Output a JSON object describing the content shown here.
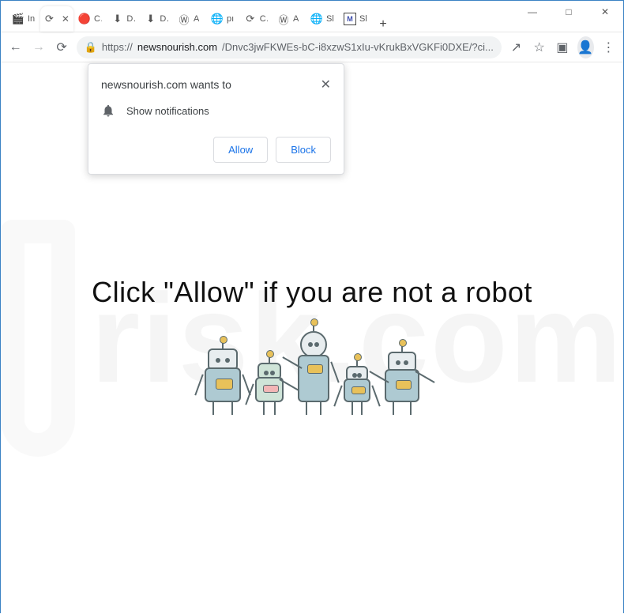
{
  "window": {
    "controls": {
      "minimize": "—",
      "maximize": "□",
      "close": "✕"
    }
  },
  "tabs": [
    {
      "icon": "🎬",
      "label": "In"
    },
    {
      "icon": "⟳",
      "label": ""
    },
    {
      "icon": "🔴",
      "label": "Cl"
    },
    {
      "icon": "⬇",
      "label": "Dı"
    },
    {
      "icon": "⬇",
      "label": "Dı"
    },
    {
      "icon": "Ⓦ",
      "label": "A"
    },
    {
      "icon": "🌐",
      "label": "pı"
    },
    {
      "icon": "⟳",
      "label": "Cl"
    },
    {
      "icon": "Ⓦ",
      "label": "A"
    },
    {
      "icon": "🌐",
      "label": "Sl"
    },
    {
      "icon": "M",
      "label": "Sl"
    }
  ],
  "newtab": "+",
  "toolbar": {
    "back": "←",
    "forward": "→",
    "reload": "⟳",
    "lock": "🔒",
    "scheme": "https://",
    "host": "newsnourish.com",
    "path": "/Dnvc3jwFKWEs-bC-i8xzwS1xIu-vKrukBxVGKFi0DXE/?ci...",
    "share": "↗",
    "star": "☆",
    "box": "▣",
    "profile": "👤",
    "menu": "⋮"
  },
  "popup": {
    "title": "newsnourish.com wants to",
    "close": "✕",
    "line": "Show notifications",
    "allow": "Allow",
    "block": "Block"
  },
  "page": {
    "headline": "Click \"Allow\"   if you are not   a robot"
  },
  "watermark": "risk.com"
}
